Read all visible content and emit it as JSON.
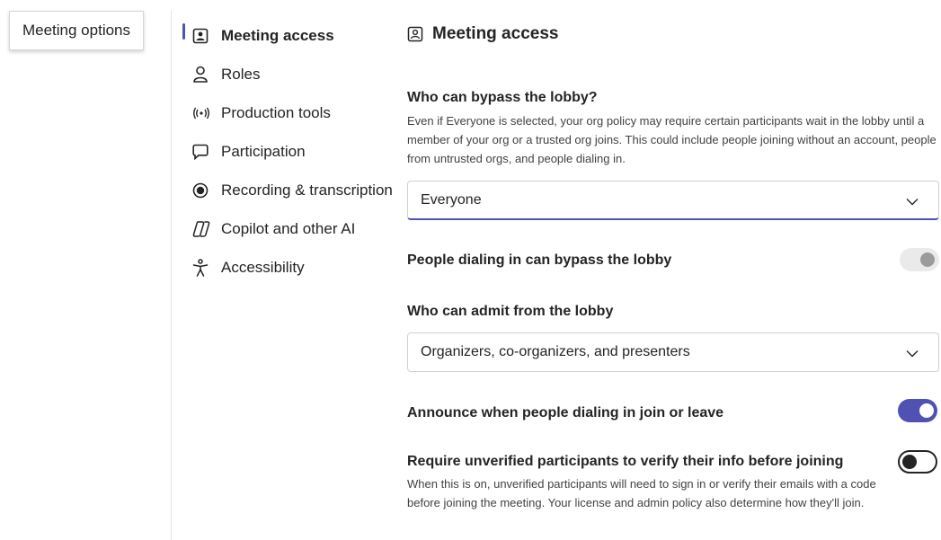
{
  "callout": {
    "label": "Meeting options"
  },
  "sidebar": {
    "items": [
      {
        "label": "Meeting access",
        "icon": "meeting-access-icon",
        "active": true
      },
      {
        "label": "Roles",
        "icon": "person-icon"
      },
      {
        "label": "Production tools",
        "icon": "broadcast-icon"
      },
      {
        "label": "Participation",
        "icon": "chat-bubble-icon"
      },
      {
        "label": "Recording & transcription",
        "icon": "record-icon"
      },
      {
        "label": "Copilot and other AI",
        "icon": "copilot-icon"
      },
      {
        "label": "Accessibility",
        "icon": "accessibility-icon"
      }
    ]
  },
  "main": {
    "title": "Meeting access",
    "bypass": {
      "heading": "Who can bypass the lobby?",
      "description": "Even if Everyone is selected, your org policy may require certain participants wait in the lobby until a member of your org or a trusted org joins. This could include people joining without an account, people from untrusted orgs, and people dialing in.",
      "selected": "Everyone"
    },
    "dialing_bypass": {
      "label": "People dialing in can bypass the lobby",
      "state": "disabled"
    },
    "admit": {
      "heading": "Who can admit from the lobby",
      "selected": "Organizers, co-organizers, and presenters"
    },
    "announce": {
      "label": "Announce when people dialing in join or leave",
      "state": "on"
    },
    "verify": {
      "label": "Require unverified participants to verify their info before joining",
      "description": "When this is on, unverified participants will need to sign in or verify their emails with a code before joining the meeting. Your license and admin policy also determine how they'll join.",
      "state": "off"
    }
  },
  "colors": {
    "accent": "#4f52b2",
    "text": "#242424"
  }
}
